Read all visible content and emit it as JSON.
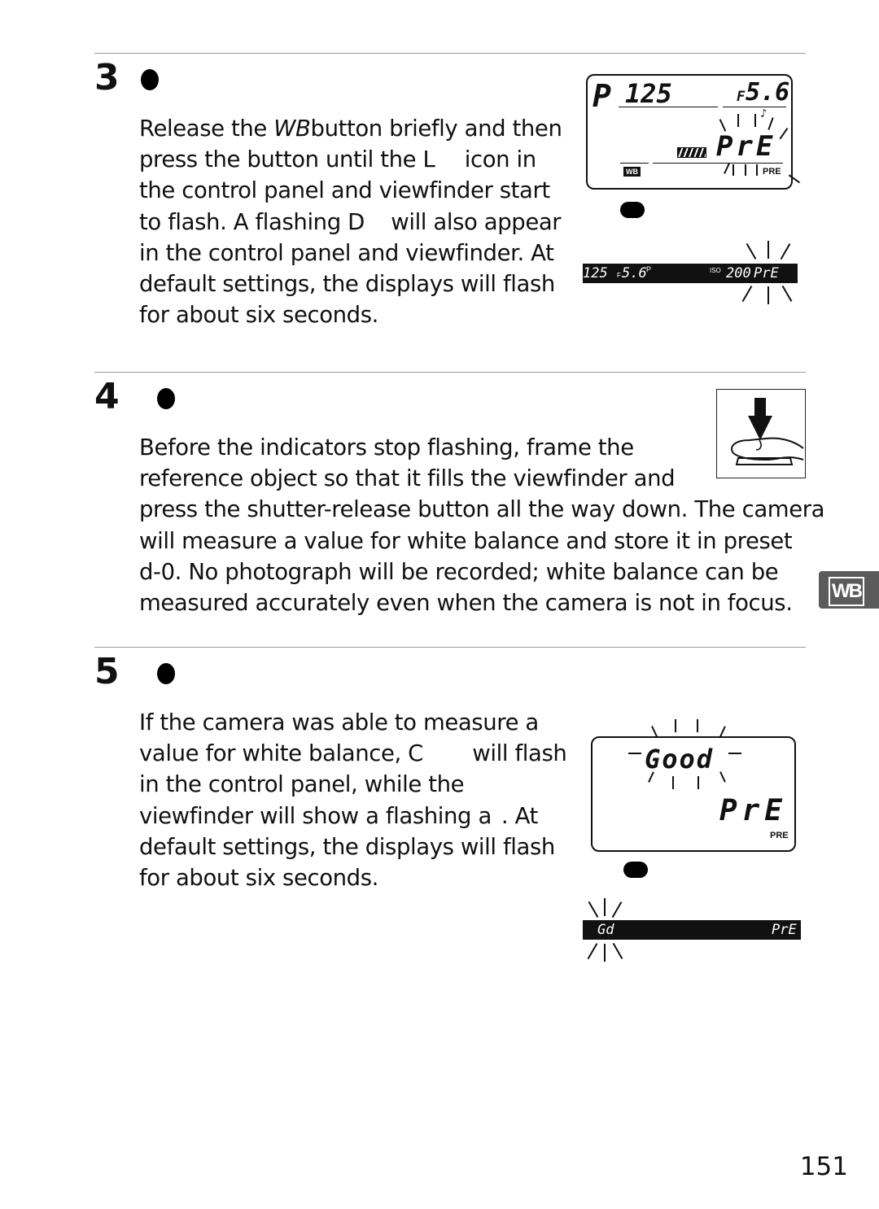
{
  "page_number": "151",
  "side_tab": {
    "label": "WB",
    "icon": "white-balance-tab-icon"
  },
  "steps": [
    {
      "number": "3",
      "lines": [
        [
          "Release the ",
          "WB",
          "button briefly and then"
        ],
        [
          "press the button until the L",
          "",
          " icon in"
        ],
        [
          "the control panel and viewfinder start"
        ],
        [
          "to flash.  A flashing D",
          "",
          " will also appear"
        ],
        [
          "in the control panel and viewfinder.  At"
        ],
        [
          "default settings, the displays will flash"
        ],
        [
          "for about six seconds."
        ]
      ],
      "control_panel": {
        "mode": "P",
        "shutter": "125",
        "aperture_prefix": "F",
        "aperture": "5.6",
        "wb_label": "WB",
        "preset": "PrE",
        "preset_label": "PRE",
        "beep": "♪"
      },
      "viewfinder": {
        "shutter": "125",
        "aperture_prefix": "F",
        "aperture": "5.6",
        "mode": "P",
        "iso_label": "ISO",
        "iso": "200",
        "preset": "PrE"
      }
    },
    {
      "number": "4",
      "lines": [
        "Before the indicators stop flashing, frame the",
        "reference object so that it fills the viewfinder and",
        "press the shutter-release button all the way down.  The camera",
        "will measure a value for white balance and store it in preset",
        "d-0.  No photograph will be recorded; white balance can be",
        "measured accurately even when the camera is not in focus."
      ],
      "illustration": "shutter-press-icon"
    },
    {
      "number": "5",
      "lines": [
        [
          "If the camera was able to measure a"
        ],
        [
          "value for white balance, C",
          "",
          " will flash"
        ],
        [
          "in the control panel, while the"
        ],
        [
          "viewfinder will show a flashing a",
          "",
          ".  At"
        ],
        [
          "default settings, the displays will flash"
        ],
        [
          "for about six seconds."
        ]
      ],
      "control_panel": {
        "status": "Good",
        "preset": "PrE",
        "preset_label": "PRE"
      },
      "viewfinder": {
        "status": "Gd",
        "preset": "PrE"
      }
    }
  ]
}
